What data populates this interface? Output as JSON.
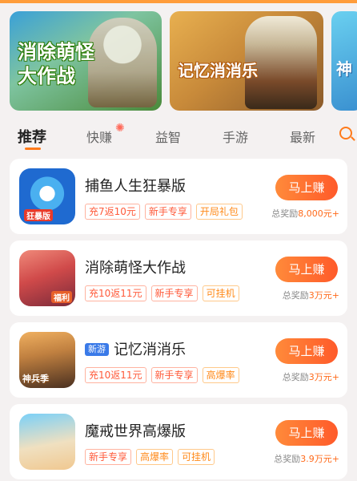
{
  "banners": [
    {
      "title": "消除萌怪大作战"
    },
    {
      "title": "记忆消消乐"
    },
    {
      "title": "神"
    }
  ],
  "tabs": [
    {
      "label": "推荐",
      "active": true
    },
    {
      "label": "快赚",
      "active": false
    },
    {
      "label": "益智",
      "active": false
    },
    {
      "label": "手游",
      "active": false
    },
    {
      "label": "最新",
      "active": false
    }
  ],
  "games": [
    {
      "name": "捕鱼人生狂暴版",
      "icon_label": "狂暴版",
      "tags": [
        "充7返10元",
        "新手专享",
        "开局礼包"
      ],
      "button": "马上赚",
      "reward_label": "总奖励",
      "reward_amount": "8,000元+"
    },
    {
      "name": "消除萌怪大作战",
      "icon_label": "福利",
      "tags": [
        "充10返11元",
        "新手专享",
        "可挂机"
      ],
      "button": "马上赚",
      "reward_label": "总奖励",
      "reward_amount": "3万元+"
    },
    {
      "name": "记忆消消乐",
      "badge": "新游",
      "icon_label": "神兵季",
      "tags": [
        "充10返11元",
        "新手专享",
        "高爆率"
      ],
      "button": "马上赚",
      "reward_label": "总奖励",
      "reward_amount": "3万元+"
    },
    {
      "name": "魔戒世界高爆版",
      "tags": [
        "新手专享",
        "高爆率",
        "可挂机"
      ],
      "button": "马上赚",
      "reward_label": "总奖励",
      "reward_amount": "3.9万元+"
    }
  ],
  "colors": {
    "accent": "#ff7a1a",
    "button": "#ff6a2a",
    "badge_new": "#3a7ae8"
  }
}
